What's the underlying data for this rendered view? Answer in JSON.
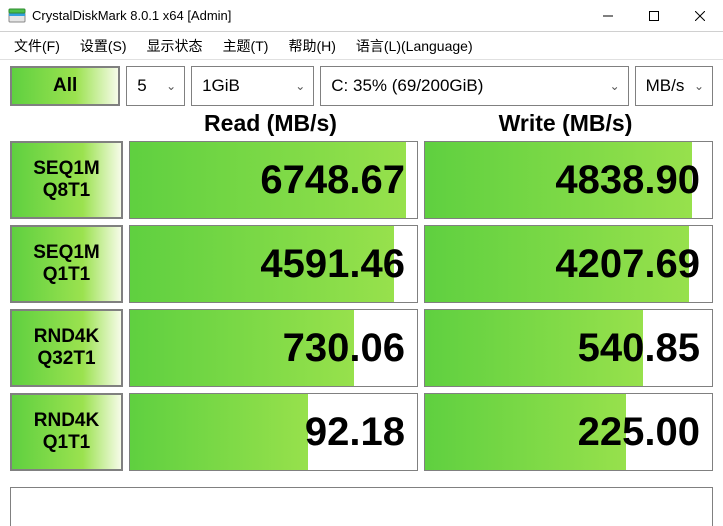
{
  "window": {
    "title": "CrystalDiskMark 8.0.1 x64 [Admin]"
  },
  "menu": {
    "file": "文件(F)",
    "settings": "设置(S)",
    "display": "显示状态",
    "theme": "主题(T)",
    "help": "帮助(H)",
    "language": "语言(L)(Language)"
  },
  "controls": {
    "all_label": "All",
    "loops": "5",
    "size": "1GiB",
    "drive": "C: 35% (69/200GiB)",
    "units": "MB/s"
  },
  "headers": {
    "read": "Read (MB/s)",
    "write": "Write (MB/s)"
  },
  "chart_data": {
    "type": "table",
    "title": "CrystalDiskMark benchmark results",
    "unit": "MB/s",
    "categories": [
      "SEQ1M Q8T1",
      "SEQ1M Q1T1",
      "RND4K Q32T1",
      "RND4K Q1T1"
    ],
    "series": [
      {
        "name": "Read (MB/s)",
        "values": [
          6748.67,
          4591.46,
          730.06,
          92.18
        ]
      },
      {
        "name": "Write (MB/s)",
        "values": [
          4838.9,
          4207.69,
          540.85,
          225.0
        ]
      }
    ],
    "row_labels": [
      {
        "l1": "SEQ1M",
        "l2": "Q8T1"
      },
      {
        "l1": "SEQ1M",
        "l2": "Q1T1"
      },
      {
        "l1": "RND4K",
        "l2": "Q32T1"
      },
      {
        "l1": "RND4K",
        "l2": "Q1T1"
      }
    ],
    "bar_pct": {
      "read": [
        96,
        92,
        78,
        62
      ],
      "write": [
        93,
        92,
        76,
        70
      ]
    }
  }
}
